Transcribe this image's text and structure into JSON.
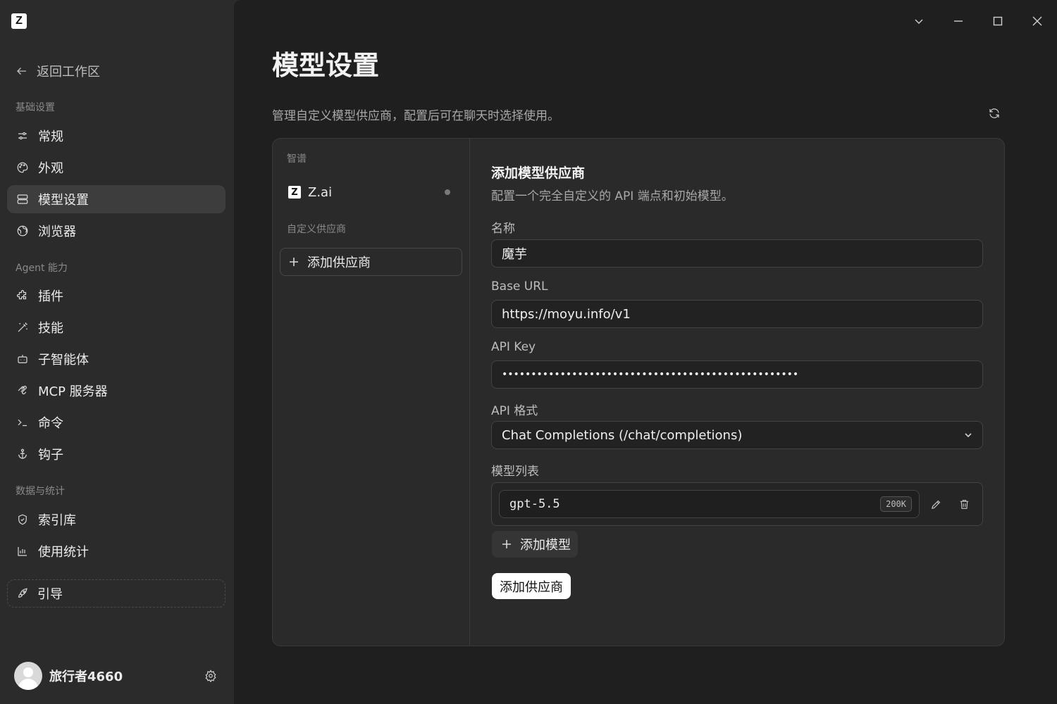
{
  "app": {
    "logo_letter": "Z"
  },
  "sidebar": {
    "back_label": "返回工作区",
    "sections": {
      "basic": "基础设置",
      "agent": "Agent 能力",
      "data": "数据与统计"
    },
    "items": [
      {
        "label": "常规",
        "icon": "sliders-icon"
      },
      {
        "label": "外观",
        "icon": "palette-icon"
      },
      {
        "label": "模型设置",
        "icon": "server-icon"
      },
      {
        "label": "浏览器",
        "icon": "globe-icon"
      },
      {
        "label": "插件",
        "icon": "puzzle-icon"
      },
      {
        "label": "技能",
        "icon": "magic-wand-icon"
      },
      {
        "label": "子智能体",
        "icon": "bot-icon"
      },
      {
        "label": "MCP 服务器",
        "icon": "mcp-icon"
      },
      {
        "label": "命令",
        "icon": "terminal-icon"
      },
      {
        "label": "钩子",
        "icon": "anchor-icon"
      },
      {
        "label": "索引库",
        "icon": "shield-icon"
      },
      {
        "label": "使用统计",
        "icon": "bar-chart-icon"
      }
    ],
    "guide_label": "引导",
    "user_name": "旅行者4660"
  },
  "main": {
    "title": "模型设置",
    "description": "管理自定义模型供应商，配置后可在聊天时选择使用。",
    "providers": {
      "group_builtin": "智谱",
      "builtin_item": "Z.ai",
      "group_custom": "自定义供应商",
      "add_label": "添加供应商"
    },
    "form": {
      "title": "添加模型供应商",
      "subtitle": "配置一个完全自定义的 API 端点和初始模型。",
      "name_label": "名称",
      "name_value": "魔芋",
      "base_url_label": "Base URL",
      "base_url_value": "https://moyu.info/v1",
      "api_key_label": "API Key",
      "api_key_value": "•••••••••••••••••••••••••••••••••••••••••••••••••••",
      "api_format_label": "API 格式",
      "api_format_value": "Chat Completions (/chat/completions)",
      "model_list_label": "模型列表",
      "models": [
        {
          "name": "gpt-5.5",
          "context": "200K"
        }
      ],
      "add_model_label": "添加模型",
      "submit_label": "添加供应商"
    }
  }
}
